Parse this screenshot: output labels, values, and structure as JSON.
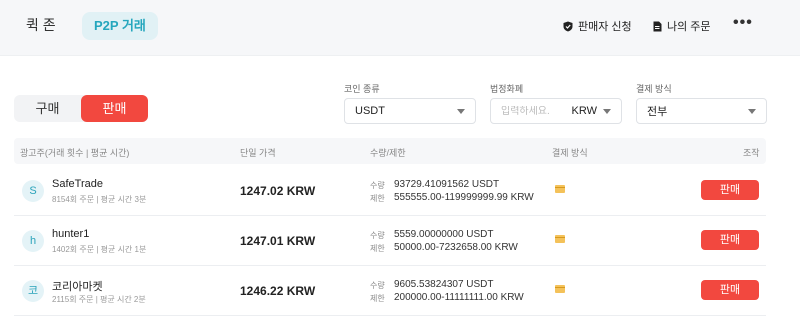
{
  "top": {
    "tab_quick": "퀵 존",
    "tab_p2p": "P2P 거래",
    "seller_apply": "판매자 신청",
    "my_orders": "나의 주문",
    "more": "•••"
  },
  "toggle": {
    "buy": "구매",
    "sell": "판매"
  },
  "filters": {
    "coin_label": "코인 종류",
    "coin_value": "USDT",
    "fiat_label": "법정화폐",
    "amount_placeholder": "입력하세요.",
    "fiat_value": "KRW",
    "pay_label": "결제 방식",
    "pay_value": "전부"
  },
  "table": {
    "headers": {
      "advertiser": "광고주(거래 횟수 | 평균 시간)",
      "price": "단일 가격",
      "qty": "수량/제한",
      "pay": "결제 방식",
      "action": "조작"
    },
    "qty_label": "수량",
    "limit_label": "제한",
    "rows": [
      {
        "avatar": "S",
        "name": "SafeTrade",
        "stats": "8154회 주문 | 평균 시간 3분",
        "price": "1247.02 KRW",
        "qty": "93729.41091562 USDT",
        "limit": "555555.00-119999999.99 KRW",
        "action": "판매"
      },
      {
        "avatar": "h",
        "name": "hunter1",
        "stats": "1402회 주문 | 평균 시간 1분",
        "price": "1247.01 KRW",
        "qty": "5559.00000000 USDT",
        "limit": "50000.00-7232658.00 KRW",
        "action": "판매"
      },
      {
        "avatar": "코",
        "name": "코리아마켓",
        "stats": "2115회 주문 | 평균 시간 2분",
        "price": "1246.22 KRW",
        "qty": "9605.53824307 USDT",
        "limit": "200000.00-11111111.00 KRW",
        "action": "판매"
      }
    ]
  },
  "colors": {
    "accent": "#24a6bd",
    "sell": "#f2483f",
    "pay_card": "#f4c25a"
  }
}
